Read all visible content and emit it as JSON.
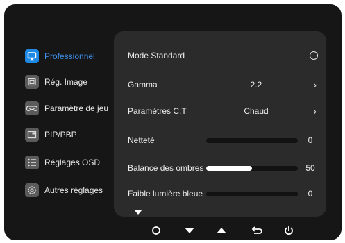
{
  "sidebar": {
    "items": [
      {
        "label": "Professionnel",
        "icon": "monitor-icon",
        "active": true
      },
      {
        "label": "Rég. Image",
        "icon": "image-adjust-icon",
        "active": false
      },
      {
        "label": "Paramètre de jeu",
        "icon": "gamepad-icon",
        "active": false
      },
      {
        "label": "PIP/PBP",
        "icon": "pip-icon",
        "active": false
      },
      {
        "label": "Réglages OSD",
        "icon": "list-icon",
        "active": false
      },
      {
        "label": "Autres réglages",
        "icon": "gear-icon",
        "active": false
      }
    ]
  },
  "panel": {
    "mode": {
      "label": "Mode Standard"
    },
    "gamma": {
      "label": "Gamma",
      "value": "2.2"
    },
    "ct": {
      "label": "Paramètres C.T",
      "value": "Chaud"
    },
    "sharpness": {
      "label": "Netteté",
      "value": "0",
      "level": 0
    },
    "shadow": {
      "label": "Balance des ombres",
      "value": "50",
      "level": 50
    },
    "blue": {
      "label": "Faible lumière bleue",
      "value": "0",
      "level": 0
    }
  },
  "controls": {
    "buttons": [
      "circle-button",
      "down-button",
      "up-button",
      "back-button",
      "power-button"
    ]
  },
  "colors": {
    "accent": "#1e88e5",
    "background": "#161616",
    "panel": "#2b2b2b"
  }
}
